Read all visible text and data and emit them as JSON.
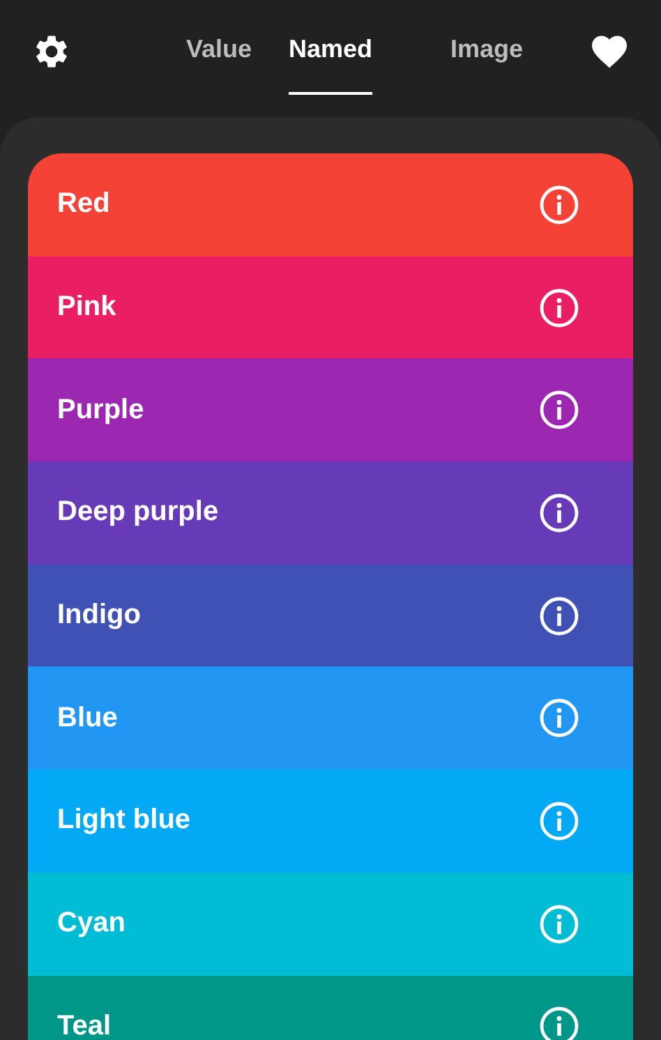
{
  "tabs": [
    {
      "label": "Value",
      "selected": false
    },
    {
      "label": "Named",
      "selected": true
    },
    {
      "label": "Image",
      "selected": false
    }
  ],
  "colors": [
    {
      "name": "Red",
      "color": "#f44336"
    },
    {
      "name": "Pink",
      "color": "#e91e63"
    },
    {
      "name": "Purple",
      "color": "#9c27b0"
    },
    {
      "name": "Deep purple",
      "color": "#673ab7"
    },
    {
      "name": "Indigo",
      "color": "#3f51b5"
    },
    {
      "name": "Blue",
      "color": "#2196f3"
    },
    {
      "name": "Light blue",
      "color": "#03a9f4"
    },
    {
      "name": "Cyan",
      "color": "#00bcd4"
    },
    {
      "name": "Teal",
      "color": "#009688"
    }
  ]
}
